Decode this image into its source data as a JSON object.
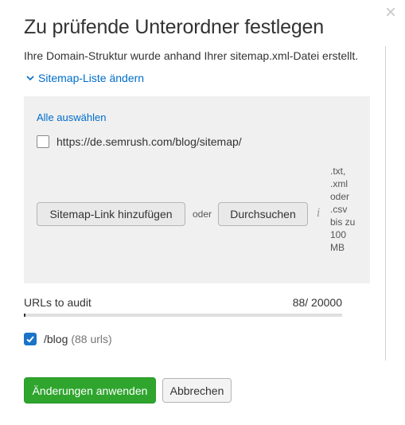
{
  "dialog": {
    "title": "Zu prüfende Unterordner festlegen",
    "close_glyph": "×",
    "intro": "Ihre Domain-Struktur wurde anhand Ihrer sitemap.xml-Datei erstellt.",
    "toggle_label": "Sitemap-Liste ändern",
    "toggle_icon": "chevron-down-icon",
    "accent_color": "#006dca"
  },
  "panel": {
    "select_all": "Alle auswählen",
    "sitemaps": [
      {
        "url": "https://de.semrush.com/blog/sitemap/",
        "checked": false
      }
    ],
    "add_link_label": "Sitemap-Link hinzufügen",
    "or_label": "oder",
    "browse_label": "Durchsuchen",
    "info_icon": "info-icon",
    "file_types": [
      ".txt,",
      ".xml",
      "oder",
      ".csv",
      "bis zu",
      "100",
      "MB"
    ]
  },
  "audit": {
    "label": "URLs to audit",
    "count": "88/ 20000",
    "progress_fraction": 0.0044
  },
  "subfolders": [
    {
      "path": "/blog",
      "count": "(88 urls)",
      "checked": true,
      "check_color": "#1a73c8"
    }
  ],
  "footer": {
    "apply_label": "Änderungen anwenden",
    "apply_color": "#2fa52e",
    "cancel_label": "Abbrechen"
  }
}
